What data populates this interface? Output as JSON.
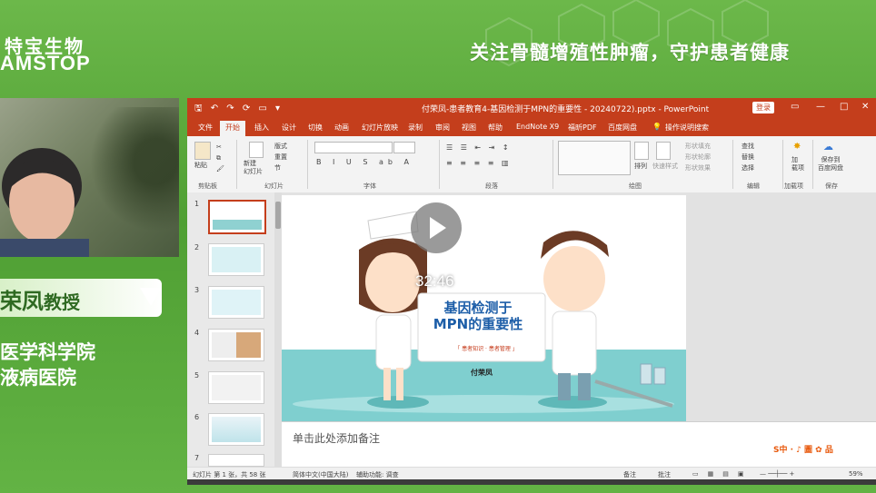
{
  "broadcast": {
    "logo_cn": "特宝生物",
    "logo_en": "AMSTOP",
    "slogan": "关注骨髓增殖性肿瘤，守护患者健康",
    "speaker_name": "荣凤",
    "speaker_title": "教授",
    "affiliation_line1": "医学科学院",
    "affiliation_line2": "液病医院"
  },
  "window": {
    "quick_access": "🖫 ↶ ↷ ⟳ ▭ ▾",
    "title": "付荣凤-患者教育4-基因检测于MPN的重要性 - 20240722).pptx  -  PowerPoint",
    "login_label": "登录",
    "controls": [
      "▭",
      "—",
      "□",
      "✕"
    ]
  },
  "ribbon_tabs": [
    "文件",
    "开始",
    "插入",
    "设计",
    "切换",
    "动画",
    "幻灯片放映",
    "录制",
    "审阅",
    "视图",
    "帮助",
    "EndNote X9",
    "福昕PDF",
    "百度网盘",
    "操作说明搜索"
  ],
  "active_tab": "开始",
  "ribbon": {
    "paste": "粘贴",
    "new_slide": "新建\n幻灯片",
    "layout": "版式",
    "reset": "重置",
    "section": "节",
    "find": "查找",
    "replace": "替换",
    "select": "选择",
    "arrange": "排列",
    "quick_styles": "快速样式",
    "shape_fill": "形状填充",
    "shape_outline": "形状轮廓",
    "shape_effects": "形状效果",
    "addin": "加\n载项",
    "save_to": "保存到\n百度网盘",
    "groups": [
      "剪贴板",
      "幻灯片",
      "字体",
      "段落",
      "绘图",
      "编辑",
      "加载项",
      "保存"
    ]
  },
  "thumbnails": [
    "1",
    "2",
    "3",
    "4",
    "5",
    "6",
    "7"
  ],
  "slide": {
    "title_line1": "基因检测于",
    "title_line2": "MPN的重要性",
    "subtitle": "「 患者知识 · 患者管理 」",
    "author": "付荣凤"
  },
  "video_overlay": {
    "time": "32:46"
  },
  "notes_placeholder": "单击此处添加备注",
  "status_bar": {
    "slide_info": "幻灯片 第 1 张，共 58 张",
    "language": "简体中文(中国大陆)",
    "accessibility": "辅助功能: 调查",
    "notes": "备注",
    "comments": "批注",
    "zoom": "59%"
  },
  "ime": {
    "label": "S中 · ♪ 圖 ✿ 品"
  },
  "colors": {
    "ppt_red": "#c43e1c",
    "green_bg": "#5aa83a",
    "slide_blue": "#1d5ea8"
  }
}
